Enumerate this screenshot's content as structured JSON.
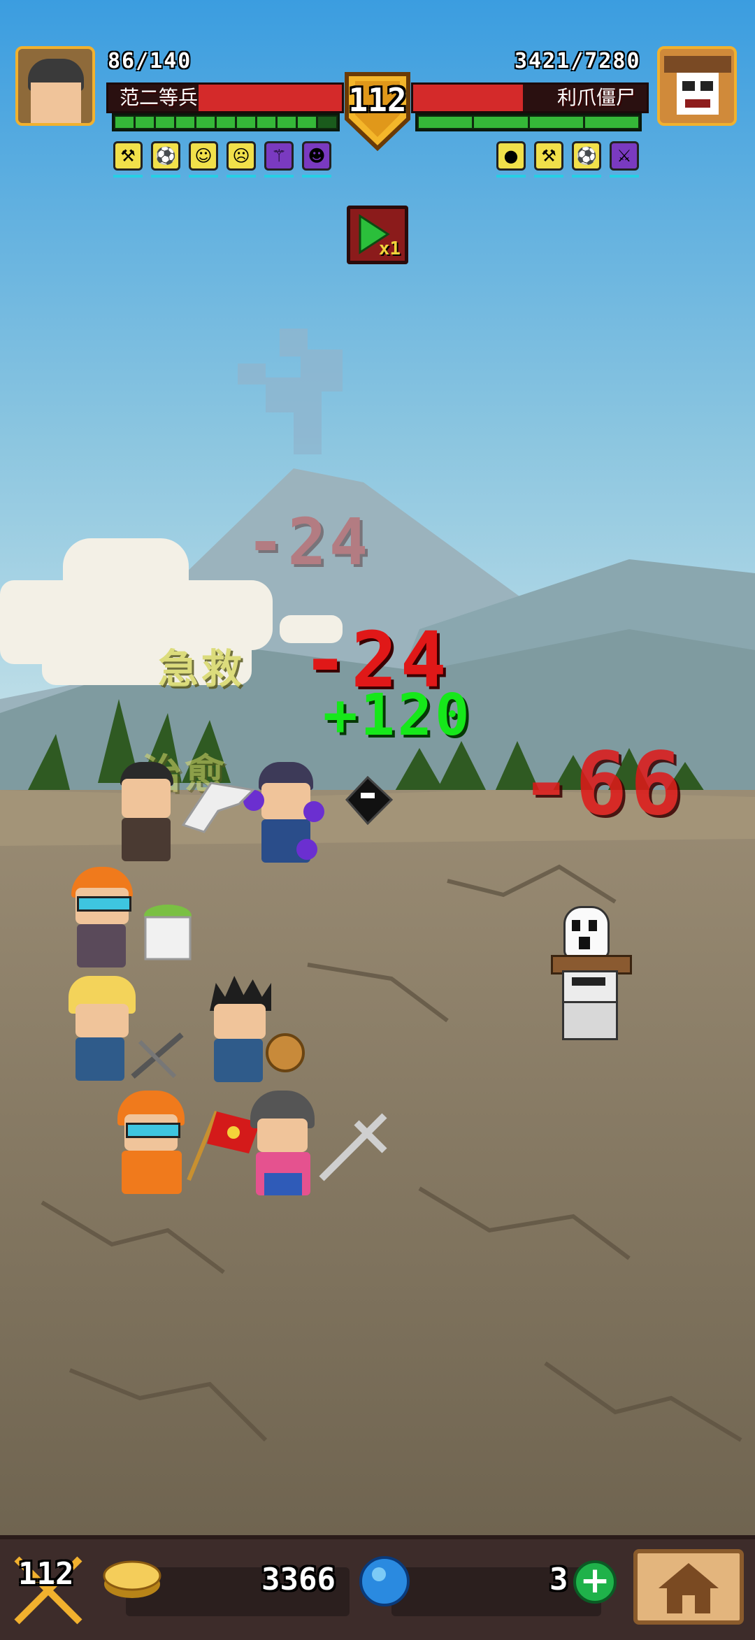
{
  "player": {
    "name": "范二等兵",
    "hp_text": "86/140",
    "hp_fraction": 0.614,
    "energy_filled": 10,
    "energy_total": 11,
    "buff_icons": [
      "axe-buff-icon",
      "ball-buff-icon",
      "smile-buff-icon",
      "angry-buff-icon",
      "staff-buff-icon",
      "zombie-buff-icon"
    ]
  },
  "enemy": {
    "name": "利爪僵尸",
    "hp_text": "3421/7280",
    "hp_fraction": 0.47,
    "energy_filled": 4,
    "energy_total": 4,
    "buff_icons": [
      "pear-buff-icon",
      "axe-buff-icon",
      "ball-buff-icon",
      "sword-buff-icon"
    ]
  },
  "level": "112",
  "speed_multiplier": "x1",
  "floating_text": {
    "dmg_faded": "-24",
    "dmg_main": "-24",
    "heal": "+120",
    "dmg_enemy": "-66",
    "skill_1": "急救",
    "skill_2": "治愈"
  },
  "bottom": {
    "level": "112",
    "gold": "3366",
    "gems": "3",
    "plus_label": "+"
  },
  "colors": {
    "sky_top": "#3b9de0",
    "sky_bottom": "#bfe1ec",
    "ground": "#8a7c66",
    "hp_red": "#d42a2a",
    "energy_green": "#35b838",
    "gold_badge": "#f1b12e"
  }
}
